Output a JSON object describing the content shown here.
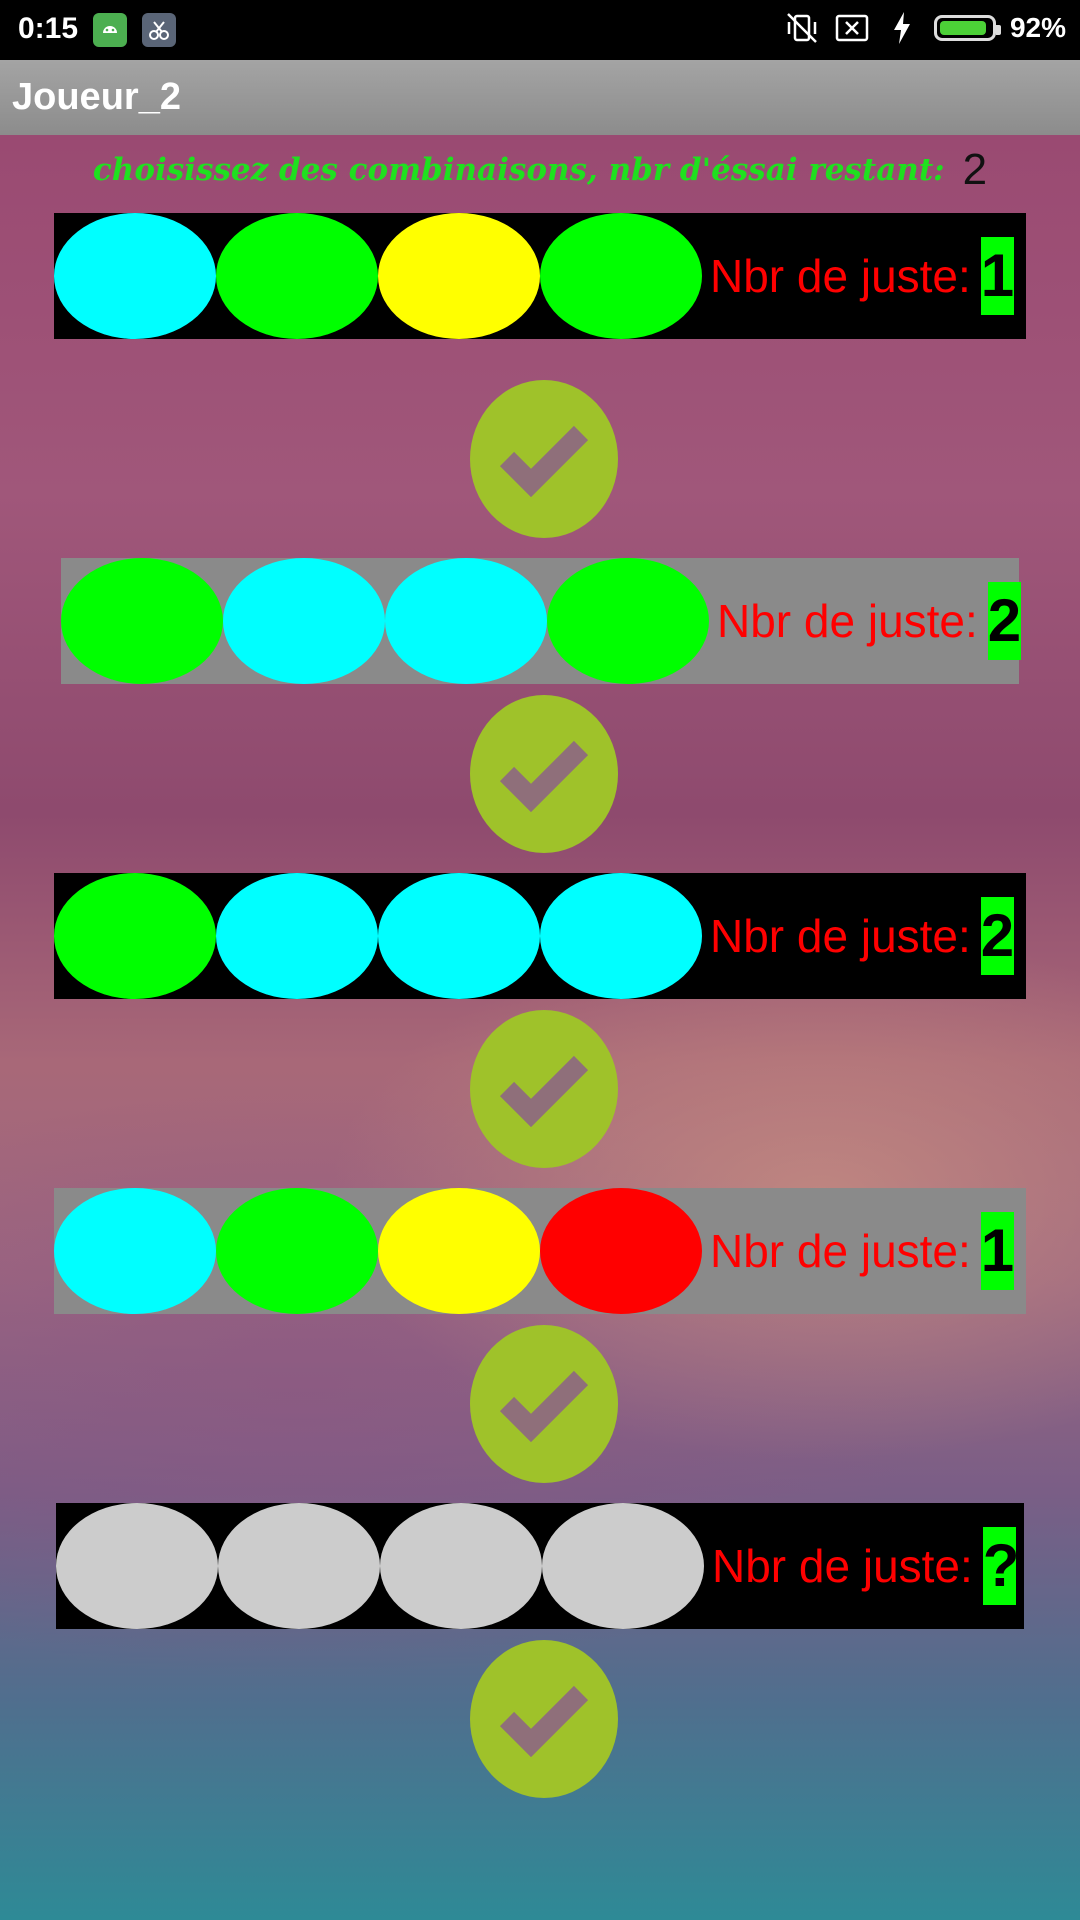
{
  "status_bar": {
    "time": "0:15",
    "battery": "92%",
    "battery_level": 0.92
  },
  "app_bar": {
    "title": "Joueur_2"
  },
  "header": {
    "prompt": "choisissez des combinaisons, nbr d'éssai restant:",
    "remaining": "2"
  },
  "colors": {
    "cyan": "#00ffff",
    "green": "#00ff00",
    "yellow": "#ffff00",
    "red": "#ff0000",
    "empty": "#cccccc",
    "check": "#9fc22a"
  },
  "attempts": [
    {
      "pegs": [
        "cyan",
        "green",
        "yellow",
        "green"
      ],
      "label": "Nbr de juste:",
      "score": "1"
    },
    {
      "pegs": [
        "green",
        "cyan",
        "cyan",
        "green"
      ],
      "label": "Nbr de juste:",
      "score": "2"
    },
    {
      "pegs": [
        "green",
        "cyan",
        "cyan",
        "cyan"
      ],
      "label": "Nbr de juste:",
      "score": "2"
    },
    {
      "pegs": [
        "cyan",
        "green",
        "yellow",
        "red"
      ],
      "label": "Nbr de juste:",
      "score": "1"
    },
    {
      "pegs": [
        "empty",
        "empty",
        "empty",
        "empty"
      ],
      "label": "Nbr de juste:",
      "score": "?"
    }
  ]
}
